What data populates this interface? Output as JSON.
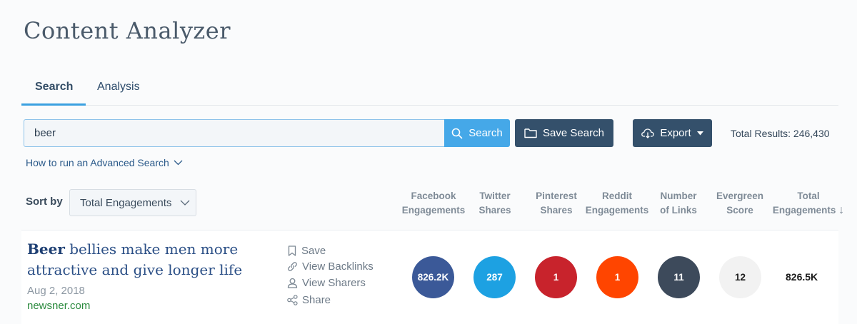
{
  "page": {
    "title": "Content Analyzer"
  },
  "tabs": [
    {
      "label": "Search",
      "active": true
    },
    {
      "label": "Analysis",
      "active": false
    }
  ],
  "search": {
    "value": "beer",
    "search_label": "Search",
    "save_label": "Save Search",
    "export_label": "Export",
    "total_results": "Total Results: 246,430"
  },
  "advanced_search": {
    "label": "How to run an Advanced Search"
  },
  "sort": {
    "label": "Sort by",
    "selected": "Total Engagements"
  },
  "columns": [
    {
      "line1": "Facebook",
      "line2": "Engagements"
    },
    {
      "line1": "Twitter",
      "line2": "Shares"
    },
    {
      "line1": "Pinterest",
      "line2": "Shares"
    },
    {
      "line1": "Reddit",
      "line2": "Engagements"
    },
    {
      "line1": "Number",
      "line2": "of Links"
    },
    {
      "line1": "Evergreen",
      "line2": "Score"
    },
    {
      "line1": "Total",
      "line2": "Engagements",
      "sort_arrow": "↓"
    }
  ],
  "results": [
    {
      "title_highlight": "Beer",
      "title_rest": " bellies make men more attractive and give longer life",
      "date": "Aug 2, 2018",
      "domain": "newsner.com",
      "actions": {
        "save": "Save",
        "backlinks": "View Backlinks",
        "sharers": "View Sharers",
        "share": "Share"
      },
      "metrics": {
        "facebook": "826.2K",
        "twitter": "287",
        "pinterest": "1",
        "reddit": "1",
        "links": "11",
        "evergreen": "12",
        "total": "826.5K"
      }
    }
  ],
  "colors": {
    "facebook": "#3b5998",
    "twitter": "#1da1e2",
    "pinterest": "#c8232c",
    "reddit": "#ff4500",
    "links": "#3d4a5b",
    "evergreen": "#f2f2f2",
    "accent": "#45a8e8",
    "dark_button": "#34506b"
  },
  "icons": [
    "search-icon",
    "folder-icon",
    "cloud-download-icon",
    "caret-down-icon",
    "chevron-down-icon",
    "bookmark-icon",
    "link-icon",
    "user-icon",
    "share-icon",
    "arrow-down-icon"
  ]
}
